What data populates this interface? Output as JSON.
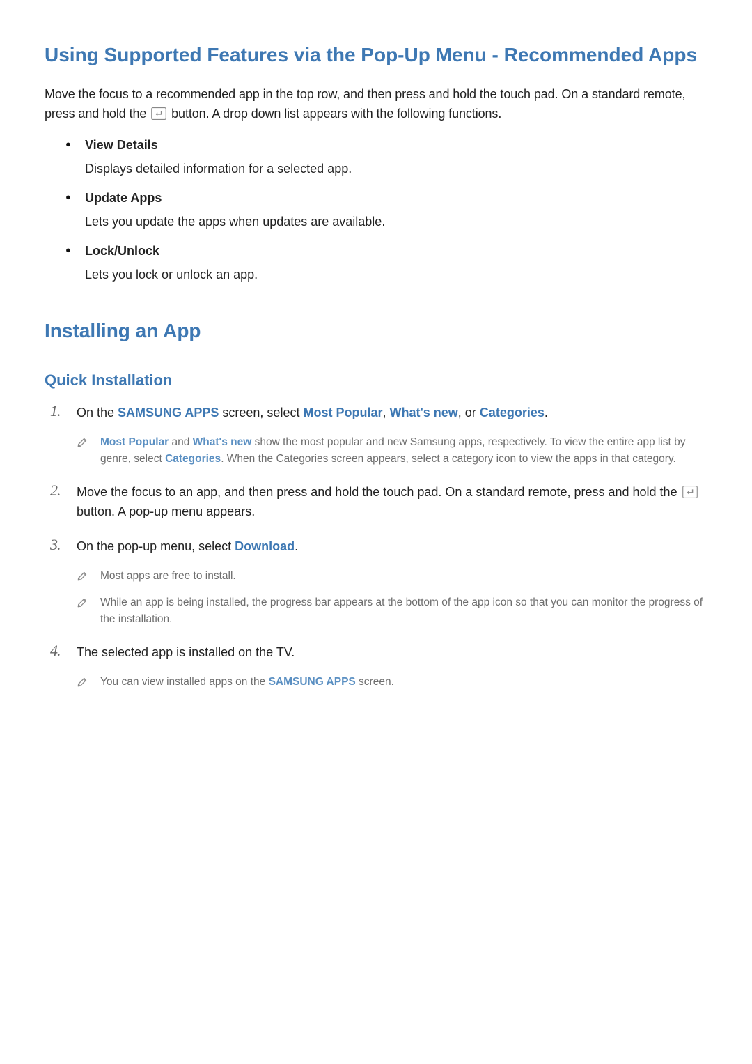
{
  "colors": {
    "accent": "#3e78b3",
    "note_text": "#6e6e6e"
  },
  "icon_names": {
    "enter_button": "enter-button-icon",
    "note_marker": "pencil-note-icon"
  },
  "section1": {
    "title": "Using Supported Features via the Pop-Up Menu - Recommended Apps",
    "intro_pre": "Move the focus to a recommended app in the top row, and then press and hold the touch pad. On a standard remote, press and hold the ",
    "intro_post": " button. A drop down list appears with the following functions.",
    "items": [
      {
        "title": "View Details",
        "desc": "Displays detailed information for a selected app."
      },
      {
        "title": "Update Apps",
        "desc": "Lets you update the apps when updates are available."
      },
      {
        "title": "Lock/Unlock",
        "desc": "Lets you lock or unlock an app."
      }
    ]
  },
  "section2": {
    "title": "Installing an App",
    "subsection_title": "Quick Installation",
    "steps": {
      "s1": {
        "pre": "On the ",
        "samsung_apps": "SAMSUNG APPS",
        "mid1": " screen, select ",
        "most_popular": "Most Popular",
        "sep1": ", ",
        "whats_new": "What's new",
        "sep2": ", or ",
        "categories": "Categories",
        "post": ".",
        "note": {
          "n1_most_popular": "Most Popular",
          "n1_and": " and ",
          "n1_whats_new": "What's new",
          "n1_mid": " show the most popular and new Samsung apps, respectively. To view the entire app list by genre, select ",
          "n1_categories": "Categories",
          "n1_post": ". When the Categories screen appears, select a category icon to view the apps in that category."
        }
      },
      "s2": {
        "pre": "Move the focus to an app, and then press and hold the touch pad. On a standard remote, press and hold the ",
        "post": " button. A pop-up menu appears."
      },
      "s3": {
        "pre": "On the pop-up menu, select ",
        "download": "Download",
        "post": ".",
        "notes": [
          "Most apps are free to install.",
          "While an app is being installed, the progress bar appears at the bottom of the app icon so that you can monitor the progress of the installation."
        ]
      },
      "s4": {
        "text": "The selected app is installed on the TV.",
        "note_pre": "You can view installed apps on the ",
        "note_samsung_apps": "SAMSUNG APPS",
        "note_post": " screen."
      }
    }
  }
}
